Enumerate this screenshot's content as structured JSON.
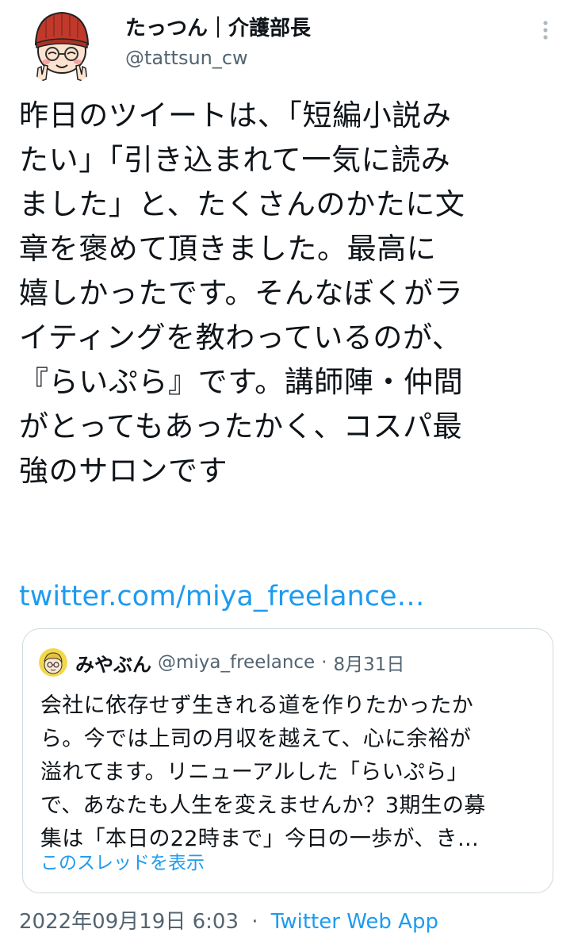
{
  "author": {
    "display_name": "たっつん｜介護部長",
    "handle": "@tattsun_cw",
    "avatar_icon": "cartoon-avatar-red-beanie-icon"
  },
  "tweet": {
    "text_lines": [
      "昨日のツイートは、「短編小説み",
      "たい」「引き込まれて一気に読み",
      "ました」と、たくさんのかたに文",
      "章を褒めて頂きました。最高に",
      "嬉しかったです。そんなぼくがラ",
      "イティングを教わっているのが、",
      "『らいぷら』です。講師陣・仲間",
      "がとってもあったかく、コスパ最",
      "強のサロンです"
    ],
    "link": "twitter.com/miya_freelance…"
  },
  "quote": {
    "name": "みやぶん",
    "handle": "@miya_freelance",
    "separator": "·",
    "date": "8月31日",
    "text_lines": [
      "会社に依存せず生きれる道を作りたかったか",
      "ら。今では上司の月収を越えて、心に余裕が",
      "溢れてます。リニューアルした「らいぷら」",
      "で、あなたも人生を変えませんか？3期生の募",
      "集は「本日の22時まで」今日の一歩が、き…"
    ],
    "show_thread": "このスレッドを表示"
  },
  "meta": {
    "timestamp": "2022年09月19日 6:03",
    "separator": "·",
    "source": "Twitter Web App"
  },
  "colors": {
    "link_blue": "#1d9bf0",
    "secondary_text": "#536471",
    "border": "#cfd9de"
  }
}
